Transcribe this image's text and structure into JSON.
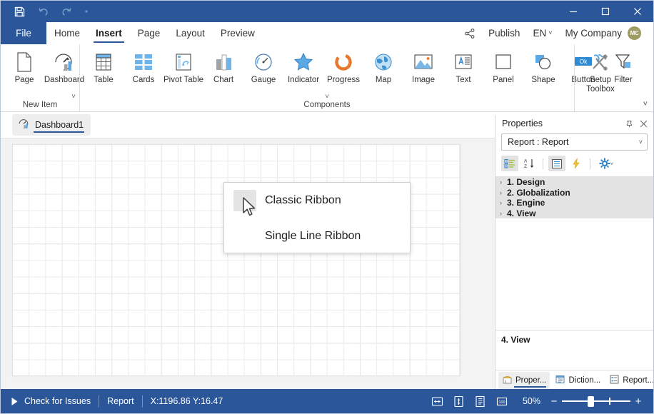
{
  "titlebar": {
    "quick_access": [
      {
        "name": "save",
        "icon": "save-icon"
      },
      {
        "name": "undo",
        "icon": "undo-icon"
      },
      {
        "name": "redo",
        "icon": "redo-icon"
      },
      {
        "name": "customize",
        "icon": "qat-dropdown-icon"
      }
    ],
    "window_controls": [
      {
        "name": "minimize",
        "glyph": "—"
      },
      {
        "name": "maximize",
        "glyph": "□"
      },
      {
        "name": "close",
        "glyph": "✕"
      }
    ]
  },
  "menubar": {
    "file_label": "File",
    "tabs": [
      {
        "label": "Home",
        "active": false
      },
      {
        "label": "Insert",
        "active": true
      },
      {
        "label": "Page",
        "active": false
      },
      {
        "label": "Layout",
        "active": false
      },
      {
        "label": "Preview",
        "active": false
      }
    ],
    "share_icon": "share-icon",
    "publish_label": "Publish",
    "language_label": "EN",
    "company_label": "My Company",
    "avatar_initials": "MC",
    "avatar_color": "#9e9b63"
  },
  "ribbon": {
    "groups": [
      {
        "title": "New Item",
        "has_chevron": false,
        "items": [
          {
            "label": "Page",
            "icon": "page-icon"
          },
          {
            "label": "Dashboard",
            "icon": "dashboard-icon"
          }
        ]
      },
      {
        "title": "Components",
        "has_chevron": true,
        "items": [
          {
            "label": "Table",
            "icon": "table-icon"
          },
          {
            "label": "Cards",
            "icon": "cards-icon"
          },
          {
            "label": "Pivot Table",
            "icon": "pivot-table-icon"
          },
          {
            "label": "Chart",
            "icon": "chart-icon"
          },
          {
            "label": "Gauge",
            "icon": "gauge-icon"
          },
          {
            "label": "Indicator",
            "icon": "indicator-star-icon"
          },
          {
            "label": "Progress",
            "icon": "progress-donut-icon"
          },
          {
            "label": "Map",
            "icon": "map-globe-icon"
          },
          {
            "label": "Image",
            "icon": "image-icon"
          },
          {
            "label": "Text",
            "icon": "text-icon"
          },
          {
            "label": "Panel",
            "icon": "panel-icon"
          },
          {
            "label": "Shape",
            "icon": "shape-icon"
          },
          {
            "label": "Button",
            "icon": "button-ok-icon"
          },
          {
            "label": "Filter",
            "icon": "filter-funnel-icon"
          }
        ]
      },
      {
        "title": "",
        "has_chevron": false,
        "items": [
          {
            "label": "Setup Toolbox",
            "icon": "setup-toolbox-icon"
          }
        ]
      }
    ],
    "collapse_icon": "chevron-down-icon"
  },
  "document_tabs": [
    {
      "label": "Dashboard1",
      "icon": "dashboard-icon",
      "active": true
    }
  ],
  "canvas": {
    "grid_visible": true
  },
  "popup_menu": {
    "items": [
      {
        "label": "Classic Ribbon",
        "checked": true
      },
      {
        "label": "Single Line Ribbon",
        "checked": false
      }
    ]
  },
  "properties": {
    "title": "Properties",
    "pin_icon": "pin-icon",
    "close_icon": "close-icon",
    "selector_value": "Report : Report",
    "toolbar": [
      {
        "name": "categorized-view",
        "icon": "categorized-icon",
        "active": true
      },
      {
        "name": "alphabetical-sort",
        "icon": "sort-az-icon",
        "active": false
      },
      {
        "name": "properties-view",
        "icon": "properties-list-icon",
        "active": true
      },
      {
        "name": "events-view",
        "icon": "lightning-icon",
        "active": false
      },
      {
        "name": "options",
        "icon": "gear-icon",
        "active": false
      }
    ],
    "categories": [
      {
        "label": "1. Design",
        "expanded": false
      },
      {
        "label": "2. Globalization",
        "expanded": false
      },
      {
        "label": "3. Engine",
        "expanded": false
      },
      {
        "label": "4. View",
        "expanded": false
      }
    ],
    "description": "4. View",
    "panel_tabs": [
      {
        "label": "Proper...",
        "icon": "properties-tab-icon",
        "active": true
      },
      {
        "label": "Diction...",
        "icon": "dictionary-tab-icon",
        "active": false
      },
      {
        "label": "Report...",
        "icon": "report-tree-tab-icon",
        "active": false
      }
    ]
  },
  "statusbar": {
    "play_icon": "play-icon",
    "check_issues_label": "Check for Issues",
    "report_label": "Report",
    "coordinates": "X:1196.86 Y:16.47",
    "view_icons": [
      {
        "name": "fit-width",
        "icon": "fit-width-icon"
      },
      {
        "name": "fit-height",
        "icon": "fit-height-icon"
      },
      {
        "name": "single-page",
        "icon": "single-page-icon"
      },
      {
        "name": "zoom-100",
        "icon": "zoom-100-icon"
      }
    ],
    "zoom_label": "50%",
    "zoom_minus": "−",
    "zoom_plus": "+"
  }
}
